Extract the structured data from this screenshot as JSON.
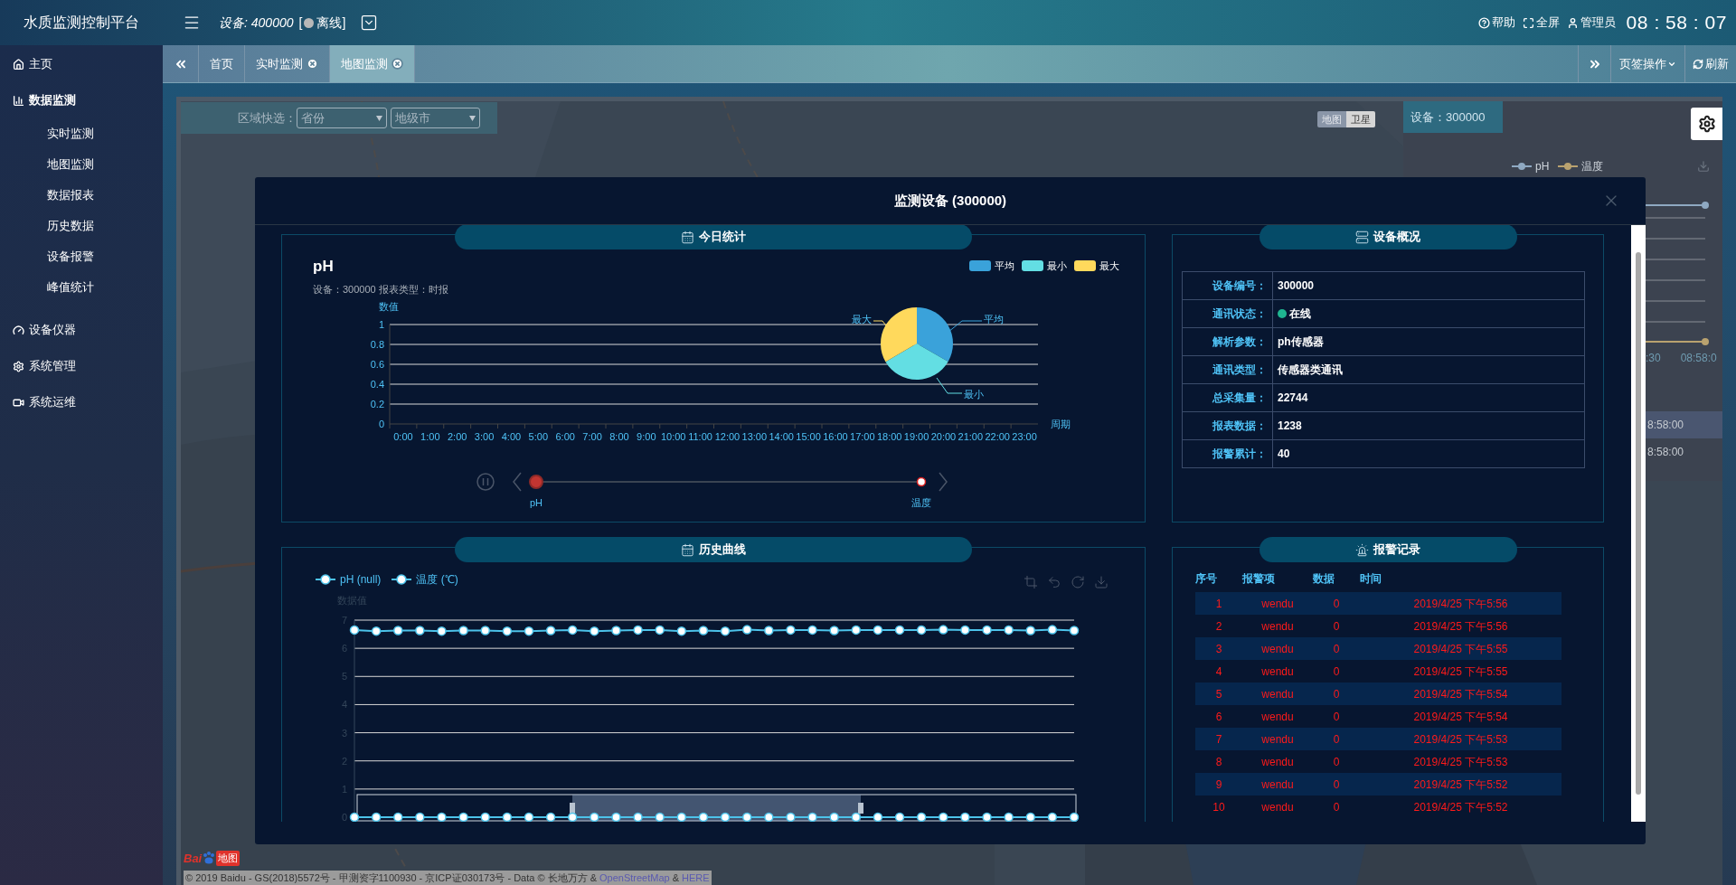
{
  "header": {
    "title": "水质监测控制平台",
    "device_label": "设备: 400000",
    "status_open": "[",
    "status_text": "离线",
    "status_close": "]",
    "online": false,
    "links": [
      {
        "label": "帮助",
        "kind": "help"
      },
      {
        "label": "全屏",
        "kind": "fullscreen"
      },
      {
        "label": "管理员",
        "kind": "user"
      }
    ],
    "clock": "08 : 58 : 07"
  },
  "sidebar": {
    "items": [
      {
        "label": "主页",
        "kind": "home",
        "expanded": false
      },
      {
        "label": "数据监测",
        "kind": "chart",
        "expanded": true,
        "children": [
          {
            "label": "实时监测"
          },
          {
            "label": "地图监测"
          },
          {
            "label": "数据报表"
          },
          {
            "label": "历史数据"
          },
          {
            "label": "设备报警"
          },
          {
            "label": "峰值统计"
          }
        ]
      },
      {
        "label": "设备仪器",
        "kind": "gauge",
        "expanded": false
      },
      {
        "label": "系统管理",
        "kind": "settings",
        "expanded": false
      },
      {
        "label": "系统运维",
        "kind": "video",
        "expanded": false
      }
    ]
  },
  "tabs": {
    "items": [
      {
        "label": "首页",
        "closable": false,
        "selected": false
      },
      {
        "label": "实时监测",
        "closable": true,
        "selected": false
      },
      {
        "label": "地图监测",
        "closable": true,
        "selected": true
      }
    ],
    "actions": "页签操作",
    "refresh": "刷新"
  },
  "map": {
    "region_label": "区域快选：",
    "selects": [
      {
        "value": "省份"
      },
      {
        "value": "地级市"
      }
    ],
    "map_types": [
      {
        "label": "地图",
        "selected": true
      },
      {
        "label": "卫星",
        "selected": false
      }
    ],
    "device_panel": {
      "title": "设备：300000",
      "legend": [
        {
          "name": "pH",
          "color": "#8fa9c2"
        },
        {
          "name": "温度",
          "color": "#b9a26f"
        }
      ],
      "axis_labels": [
        ":30",
        "08:58:0"
      ],
      "rows": [
        {
          "time": "8:58:00",
          "selected": true
        },
        {
          "time": "8:58:00",
          "selected": false
        }
      ]
    },
    "logo": {
      "left": "Bai",
      "right": "地图"
    },
    "attribution": [
      {
        "kind": "text",
        "text": "© 2019 Baidu - GS(2018)5572号 - 甲测资字1100930 - 京ICP证030173号 - Data © 长地万方 &"
      },
      {
        "kind": "link",
        "text": "OpenStreetMap"
      },
      {
        "kind": "text",
        "text": "&"
      },
      {
        "kind": "link",
        "text": "HERE"
      }
    ]
  },
  "modal": {
    "title": "监测设备 (300000)",
    "today": {
      "heading": "今日统计",
      "subtitle": "设备：300000 报表类型：时报",
      "legend": [
        {
          "name": "平均",
          "color": "#3aa2da"
        },
        {
          "name": "最小",
          "color": "#63dee3"
        },
        {
          "name": "最大",
          "color": "#ffd95c"
        }
      ],
      "chart_data": {
        "type": "bar",
        "title": "pH",
        "xlabel": "周期",
        "ylabel": "数值",
        "grid": true,
        "ylim": [
          0,
          1
        ],
        "yticks": [
          0,
          0.2,
          0.4,
          0.6,
          0.8,
          1
        ],
        "categories": [
          "0:00",
          "1:00",
          "2:00",
          "3:00",
          "4:00",
          "5:00",
          "6:00",
          "7:00",
          "8:00",
          "9:00",
          "10:00",
          "11:00",
          "12:00",
          "13:00",
          "14:00",
          "15:00",
          "16:00",
          "17:00",
          "18:00",
          "19:00",
          "20:00",
          "21:00",
          "22:00",
          "23:00"
        ],
        "values": [
          null,
          null,
          null,
          null,
          null,
          null,
          null,
          null,
          null,
          null,
          null,
          null,
          null,
          null,
          null,
          null,
          null,
          null,
          null,
          null,
          null,
          null,
          null,
          null
        ]
      },
      "pie": {
        "chart_data": {
          "type": "pie",
          "categories": [
            "平均",
            "最小",
            "最大"
          ],
          "values": [
            33.3,
            33.3,
            33.4
          ]
        }
      },
      "timeline": [
        {
          "label": "pH",
          "selected": true
        },
        {
          "label": "温度",
          "selected": false
        }
      ]
    },
    "overview": {
      "heading": "设备概况",
      "rows": [
        {
          "label": "设备编号：",
          "value": "300000"
        },
        {
          "label": "通讯状态：",
          "value": "在线",
          "color": "#1fb590"
        },
        {
          "label": "解析参数：",
          "value": "ph传感器"
        },
        {
          "label": "通讯类型：",
          "value": "传感器类通讯"
        },
        {
          "label": "总采集量：",
          "value": "22744"
        },
        {
          "label": "报表数据：",
          "value": "1238"
        },
        {
          "label": "报警累计：",
          "value": "40"
        }
      ]
    },
    "history": {
      "heading": "历史曲线",
      "chart_data": {
        "type": "line",
        "ylabel": "数据值",
        "grid": true,
        "ylim": [
          0,
          7
        ],
        "yticks": [
          0,
          1,
          2,
          3,
          4,
          5,
          6,
          7
        ],
        "series": [
          {
            "name": "pH (null)",
            "color": "#4cc3ea",
            "marker": true,
            "values": [
              0,
              0,
              0,
              0,
              0,
              0,
              0,
              0,
              0,
              0,
              0,
              0,
              0,
              0,
              0,
              0,
              0,
              0,
              0,
              0,
              0,
              0,
              0,
              0,
              0,
              0,
              0,
              0,
              0,
              0,
              0,
              0,
              0,
              0
            ]
          },
          {
            "name": "温度 (℃)",
            "color": "#4cc3ea",
            "marker": true,
            "values": [
              6.65,
              6.61,
              6.63,
              6.63,
              6.61,
              6.63,
              6.63,
              6.61,
              6.61,
              6.63,
              6.65,
              6.61,
              6.63,
              6.65,
              6.65,
              6.61,
              6.63,
              6.61,
              6.66,
              6.63,
              6.65,
              6.65,
              6.63,
              6.65,
              6.65,
              6.65,
              6.65,
              6.66,
              6.65,
              6.65,
              6.65,
              6.63,
              6.66,
              6.63
            ]
          }
        ]
      }
    },
    "alarms": {
      "heading": "报警记录",
      "columns": [
        "序号",
        "报警项",
        "数据",
        "时间"
      ],
      "rows": [
        {
          "cells": [
            "1",
            "wendu",
            "0",
            "2019/4/25 下午5:56"
          ]
        },
        {
          "cells": [
            "2",
            "wendu",
            "0",
            "2019/4/25 下午5:56"
          ]
        },
        {
          "cells": [
            "3",
            "wendu",
            "0",
            "2019/4/25 下午5:55"
          ]
        },
        {
          "cells": [
            "4",
            "wendu",
            "0",
            "2019/4/25 下午5:55"
          ]
        },
        {
          "cells": [
            "5",
            "wendu",
            "0",
            "2019/4/25 下午5:54"
          ]
        },
        {
          "cells": [
            "6",
            "wendu",
            "0",
            "2019/4/25 下午5:54"
          ]
        },
        {
          "cells": [
            "7",
            "wendu",
            "0",
            "2019/4/25 下午5:53"
          ]
        },
        {
          "cells": [
            "8",
            "wendu",
            "0",
            "2019/4/25 下午5:53"
          ]
        },
        {
          "cells": [
            "9",
            "wendu",
            "0",
            "2019/4/25 下午5:52"
          ]
        },
        {
          "cells": [
            "10",
            "wendu",
            "0",
            "2019/4/25 下午5:52"
          ]
        }
      ]
    }
  }
}
